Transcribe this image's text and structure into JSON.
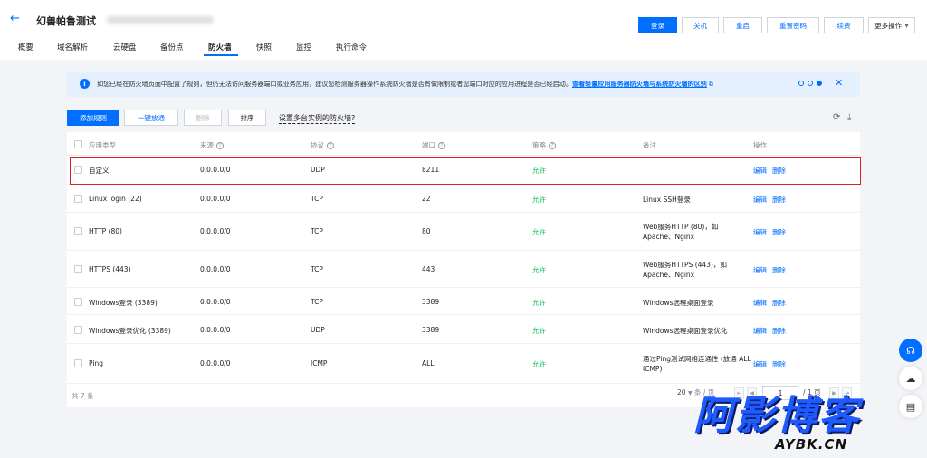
{
  "header": {
    "title": "幻兽帕鲁测试",
    "buttons": {
      "login": "登录",
      "shutdown": "关机",
      "restart": "重启",
      "reset_password": "重置密码",
      "renew": "续费",
      "more": "更多操作"
    }
  },
  "tabs": [
    "概要",
    "域名解析",
    "云硬盘",
    "备份点",
    "防火墙",
    "快照",
    "监控",
    "执行命令"
  ],
  "active_tab": "防火墙",
  "notice": {
    "text": "如您已经在防火墙页面中配置了规则，但仍无法访问服务器端口或业务应用，建议您检测服务器操作系统防火墙是否有做限制或者您端口对应的应用进程是否已经启动。",
    "link": "查看轻量应用服务器防火墙与系统防火墙的区别"
  },
  "toolbar": {
    "add_rule": "添加规则",
    "one_click": "一键放通",
    "delete": "删除",
    "sort": "排序",
    "multi_instance": "设置多台实例的防火墙?"
  },
  "table": {
    "headers": {
      "app_type": "应用类型",
      "source": "来源",
      "protocol": "协议",
      "port": "端口",
      "policy": "策略",
      "note": "备注",
      "ops": "操作"
    },
    "op_edit": "编辑",
    "op_delete": "删除",
    "rows": [
      {
        "app_type": "自定义",
        "source": "0.0.0.0/0",
        "protocol": "UDP",
        "port": "8211",
        "policy": "允许",
        "note": ""
      },
      {
        "app_type": "Linux login (22)",
        "source": "0.0.0.0/0",
        "protocol": "TCP",
        "port": "22",
        "policy": "允许",
        "note": "Linux SSH登录"
      },
      {
        "app_type": "HTTP (80)",
        "source": "0.0.0.0/0",
        "protocol": "TCP",
        "port": "80",
        "policy": "允许",
        "note": "Web服务HTTP (80)，如 Apache、Nginx"
      },
      {
        "app_type": "HTTPS (443)",
        "source": "0.0.0.0/0",
        "protocol": "TCP",
        "port": "443",
        "policy": "允许",
        "note": "Web服务HTTPS (443)，如 Apache、Nginx"
      },
      {
        "app_type": "Windows登录 (3389)",
        "source": "0.0.0.0/0",
        "protocol": "TCP",
        "port": "3389",
        "policy": "允许",
        "note": "Windows远程桌面登录"
      },
      {
        "app_type": "Windows登录优化 (3389)",
        "source": "0.0.0.0/0",
        "protocol": "UDP",
        "port": "3389",
        "policy": "允许",
        "note": "Windows远程桌面登录优化"
      },
      {
        "app_type": "Ping",
        "source": "0.0.0.0/0",
        "protocol": "ICMP",
        "port": "ALL",
        "policy": "允许",
        "note": "通过Ping测试网络连通性 (放通 ALL ICMP)"
      }
    ]
  },
  "footer": {
    "total": "共 7 条",
    "page_size": "20",
    "per_page": "条 / 页",
    "page": "1",
    "page_total": "/ 1 页"
  },
  "watermark": {
    "main": "阿影博客",
    "sub": "AYBK.CN"
  },
  "colors": {
    "accent": "#006eff",
    "allow": "#0abf5b",
    "highlight": "#e02020"
  }
}
